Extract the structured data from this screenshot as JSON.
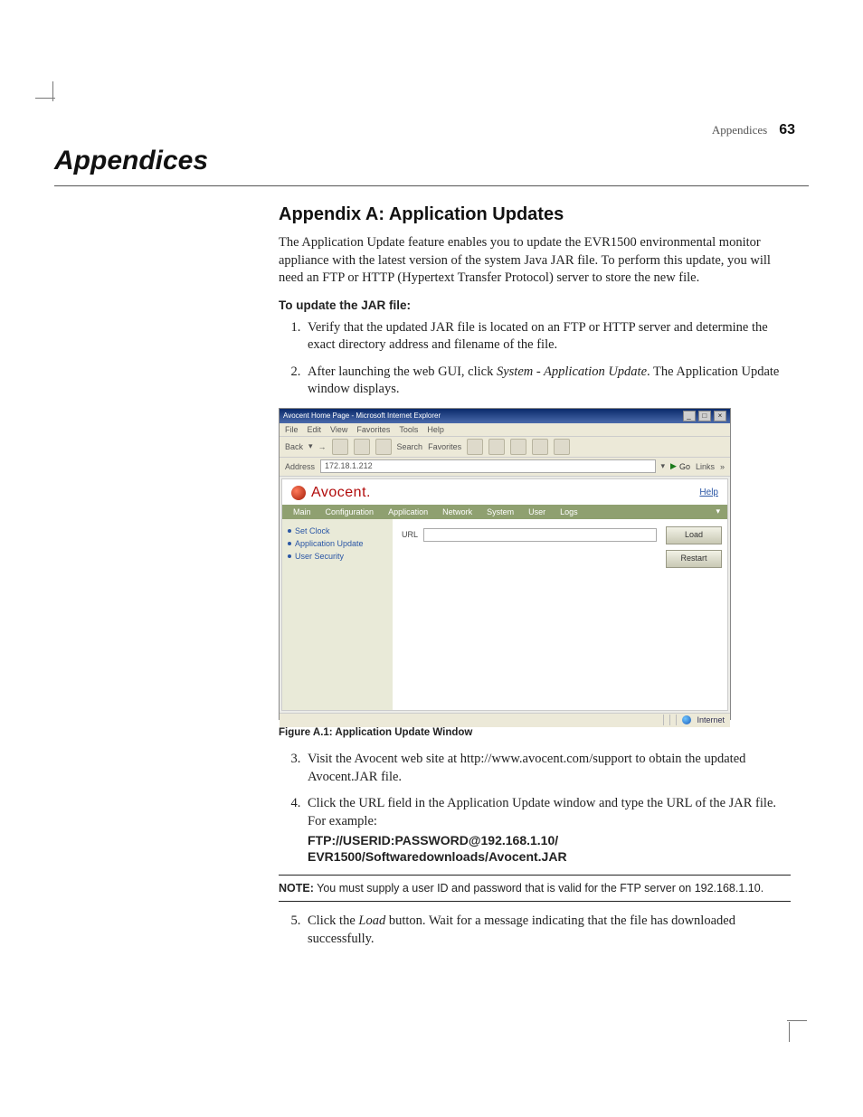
{
  "header": {
    "running_head": "Appendices",
    "page_number": "63"
  },
  "chapter_title": "Appendices",
  "section_title": "Appendix A: Application Updates",
  "intro": "The Application Update feature enables you to update the EVR1500 environmental monitor appliance with the latest version of the system Java JAR file. To perform this update, you will need an FTP or HTTP (Hypertext Transfer Protocol) server to store the new file.",
  "procedure_title": "To update the JAR file:",
  "steps": {
    "s1": "Verify that the updated JAR file is located on an FTP or HTTP server and determine the exact directory address and filename of the file.",
    "s2_pre": "After launching the web GUI, click ",
    "s2_em": "System - Application Update",
    "s2_post": ". The Application Update window displays.",
    "s3": "Visit the Avocent web site at http://www.avocent.com/support to obtain the updated Avocent.JAR file.",
    "s4_text": "Click the URL field in the Application Update window and type the URL of the JAR file. For example:",
    "s4_code": "FTP://USERID:PASSWORD@192.168.1.10/\nEVR1500/Softwaredownloads/Avocent.JAR",
    "s5_pre": "Click the ",
    "s5_em": "Load",
    "s5_post": " button. Wait for a message indicating that the file has downloaded successfully."
  },
  "figure": {
    "caption": "Figure A.1: Application Update Window",
    "window_title": "Avocent Home Page - Microsoft Internet Explorer",
    "menubar": [
      "File",
      "Edit",
      "View",
      "Favorites",
      "Tools",
      "Help"
    ],
    "toolbar": {
      "back": "Back",
      "search": "Search",
      "favorites": "Favorites"
    },
    "address_label": "Address",
    "address_value": "172.18.1.212",
    "go": "Go",
    "links": "Links",
    "brand": "Avocent.",
    "help": "Help",
    "tabs": [
      "Main",
      "Configuration",
      "Application",
      "Network",
      "System",
      "User",
      "Logs"
    ],
    "side_items": [
      "Set Clock",
      "Application Update",
      "User Security"
    ],
    "url_label": "URL",
    "buttons": {
      "load": "Load",
      "restart": "Restart"
    },
    "status_zone": "Internet"
  },
  "note": {
    "label": "NOTE:",
    "text": " You must supply a user ID and password that is valid for the FTP server on 192.168.1.10."
  }
}
